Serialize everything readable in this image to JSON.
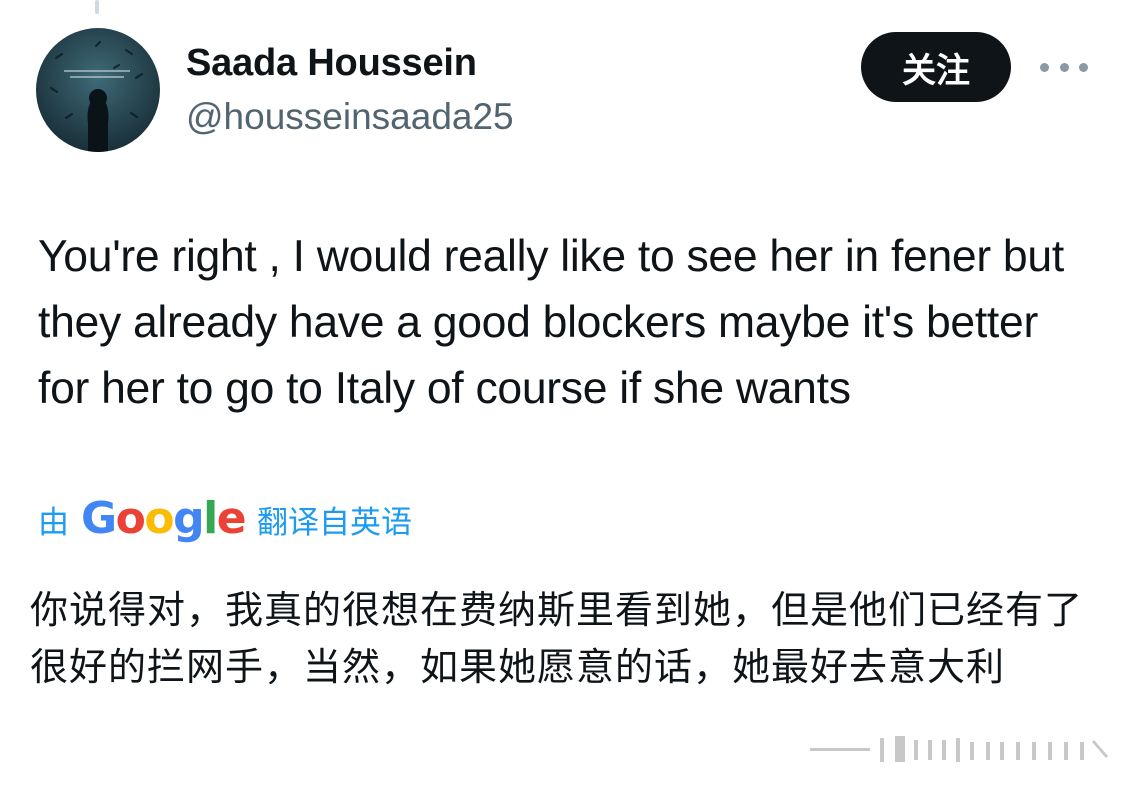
{
  "user": {
    "display_name": "Saada Houssein",
    "handle": "@housseinsaada25"
  },
  "actions": {
    "follow_label": "关注",
    "more_icon": "more-horizontal-icon"
  },
  "tweet": {
    "text": "You're right , I would really like to see her in fener but they already have a good blockers maybe it's better for her to go to Italy of course if she wants"
  },
  "translation": {
    "prefix": "由",
    "provider": "Google",
    "suffix": "翻译自英语",
    "text": "你说得对，我真的很想在费纳斯里看到她，但是他们已经有了很好的拦网手，当然，如果她愿意的话，她最好去意大利"
  },
  "colors": {
    "link": "#1d9bf0",
    "secondary_text": "#536471",
    "follow_bg": "#0f1419"
  }
}
